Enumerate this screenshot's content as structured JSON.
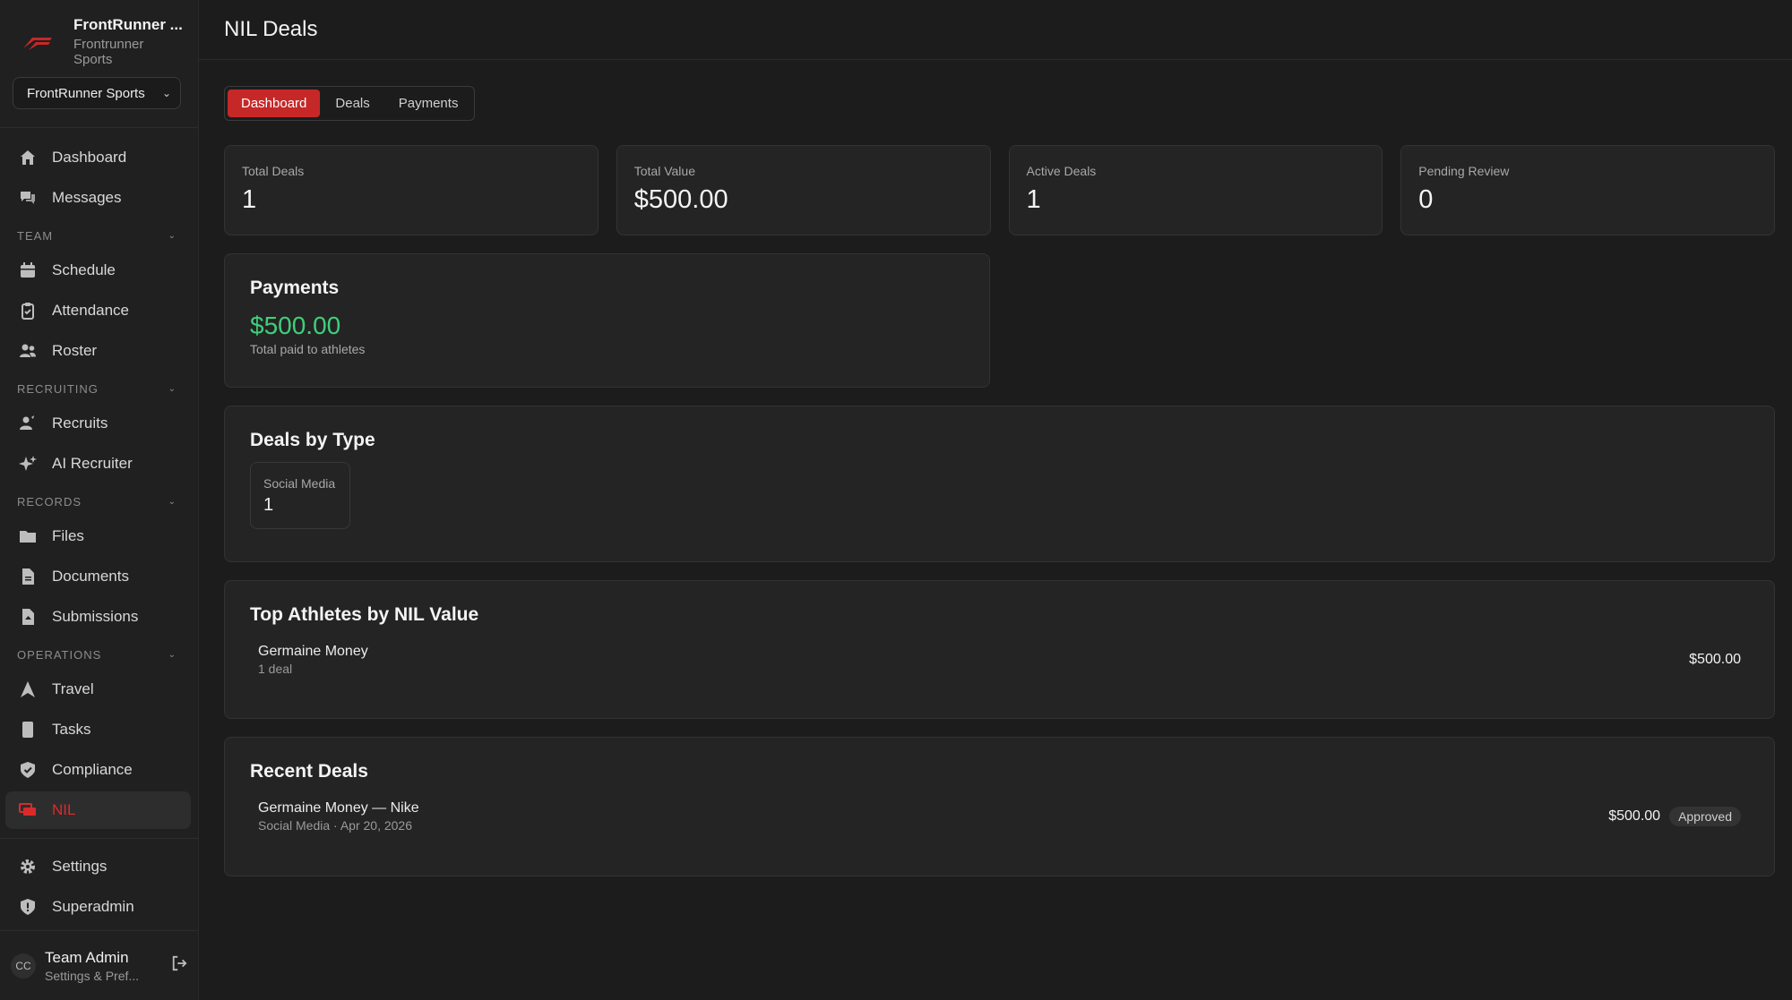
{
  "brand": {
    "name": "FrontRunner ...",
    "subtitle": "Frontrunner Sports",
    "org_select": "FrontRunner Sports"
  },
  "nav": {
    "dashboard": "Dashboard",
    "messages": "Messages",
    "sections": {
      "team": "TEAM",
      "recruiting": "RECRUITING",
      "records": "RECORDS",
      "operations": "OPERATIONS"
    },
    "schedule": "Schedule",
    "attendance": "Attendance",
    "roster": "Roster",
    "recruits": "Recruits",
    "ai_recruiter": "AI Recruiter",
    "files": "Files",
    "documents": "Documents",
    "submissions": "Submissions",
    "travel": "Travel",
    "tasks": "Tasks",
    "compliance": "Compliance",
    "nil": "NIL",
    "settings": "Settings",
    "superadmin": "Superadmin"
  },
  "user": {
    "initials": "CC",
    "name": "Team Admin",
    "sub": "Settings & Pref..."
  },
  "page": {
    "title": "NIL Deals",
    "tabs": [
      "Dashboard",
      "Deals",
      "Payments"
    ],
    "active_tab": "Dashboard"
  },
  "stats": [
    {
      "label": "Total Deals",
      "value": "1"
    },
    {
      "label": "Total Value",
      "value": "$500.00"
    },
    {
      "label": "Active Deals",
      "value": "1"
    },
    {
      "label": "Pending Review",
      "value": "0"
    }
  ],
  "payments": {
    "title": "Payments",
    "amount": "$500.00",
    "subtitle": "Total paid to athletes"
  },
  "deals_by_type": {
    "title": "Deals by Type",
    "items": [
      {
        "label": "Social Media",
        "count": "1"
      }
    ]
  },
  "top_athletes": {
    "title": "Top Athletes by NIL Value",
    "rows": [
      {
        "name": "Germaine Money",
        "sub": "1 deal",
        "amount": "$500.00"
      }
    ]
  },
  "recent_deals": {
    "title": "Recent Deals",
    "rows": [
      {
        "title": "Germaine Money — Nike",
        "sub": "Social Media · Apr 20, 2026",
        "amount": "$500.00",
        "status": "Approved"
      }
    ]
  },
  "colors": {
    "accent": "#c62828",
    "active_nav": "#d92b2b",
    "money_green": "#3fcf7a"
  }
}
